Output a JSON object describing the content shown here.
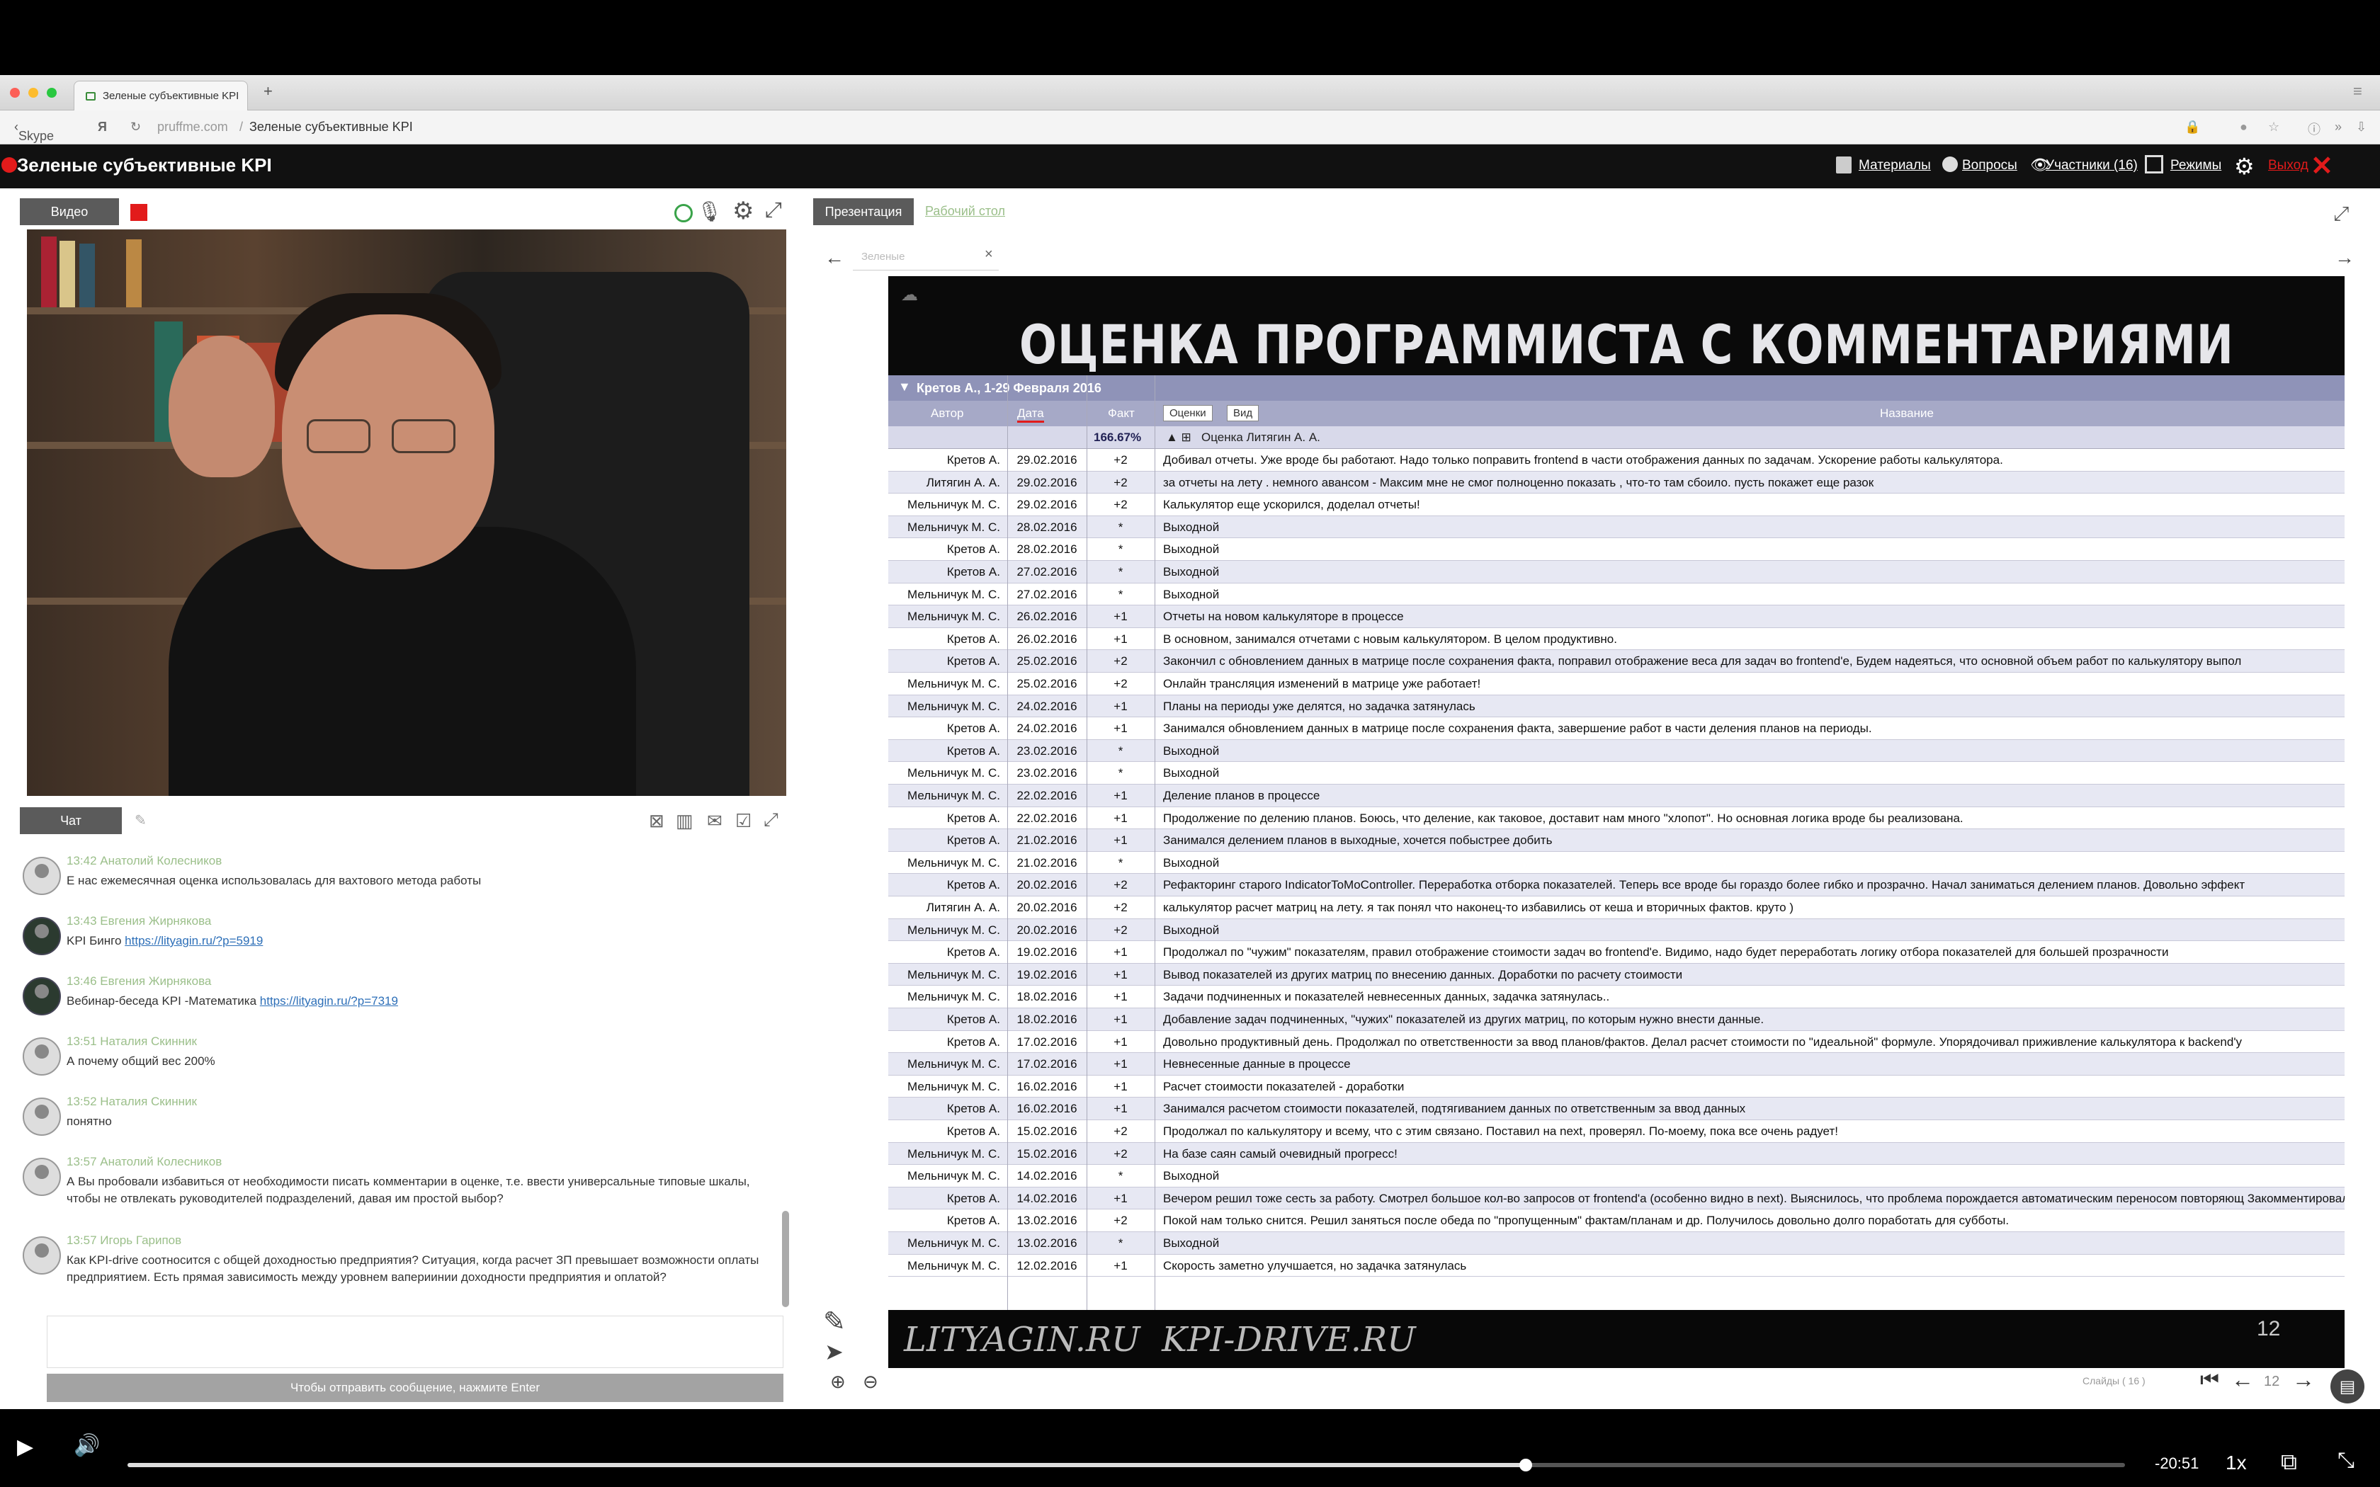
{
  "browser": {
    "tab_title": "Зеленые субъективные KPI",
    "new_tab": "+",
    "back_label": "Skype",
    "domain": "pruffme.com",
    "page_title": "Зеленые субъективные KPI"
  },
  "app": {
    "title": "Зеленые субъективные KPI",
    "nav": {
      "materials": "Материалы",
      "questions": "Вопросы",
      "participants": "Участники (16)",
      "modes": "Режимы",
      "exit": "Выход"
    }
  },
  "video_panel": {
    "tab": "Видео"
  },
  "chat": {
    "tab": "Чат",
    "messages": [
      {
        "time": "13:42",
        "author": "Анатолий Колесников",
        "text": "Е нас ежемесячная оценка использовалась для вахтового метода работы",
        "link": ""
      },
      {
        "time": "13:43",
        "author": "Евгения Жирнякова",
        "text": "KPI Бинго ",
        "link": "https://lityagin.ru/?p=5919"
      },
      {
        "time": "13:46",
        "author": "Евгения Жирнякова",
        "text": "Вебинар-беседа KPI -Математика ",
        "link": "https://lityagin.ru/?p=7319"
      },
      {
        "time": "13:51",
        "author": "Наталия Скинник",
        "text": "А почему общий вес 200%",
        "link": ""
      },
      {
        "time": "13:52",
        "author": "Наталия Скинник",
        "text": "понятно",
        "link": ""
      },
      {
        "time": "13:57",
        "author": "Анатолий Колесников",
        "text": "А Вы пробовали избавиться от необходимости писать комментарии в оценке, т.е. ввести универсальные типовые шкалы, чтобы не отвлекать руководителей подразделений, давая им простой выбор?",
        "link": ""
      },
      {
        "time": "13:57",
        "author": "Игорь Гарипов",
        "text": "Как KPI-drive соотносится с общей доходностью предприятия? Ситуация, когда расчет ЗП превышает возможности оплаты предприятием. Есть прямая зависимость между уровнем вапериинии доходности предприятия и оплатой?",
        "link": ""
      }
    ],
    "send_hint": "Чтобы отправить сообщение, нажмите Enter"
  },
  "presentation": {
    "tab": "Презентация",
    "tab2": "Рабочий стол",
    "file_field": "Зеленые",
    "slide_title": "ОЦЕНКА ПРОГРАММИСТА С КОММЕНТАРИЯМИ",
    "filter_bar": "Кретов А., 1-29 Февраля 2016",
    "headers": {
      "author": "Автор",
      "date": "Дата",
      "fact": "Факт",
      "chip1": "Оценки",
      "chip2": "Вид",
      "name": "Название"
    },
    "summary": {
      "fact": "166.67%",
      "title": "Оценка Литягин А. А."
    },
    "rows": [
      {
        "author": "Кретов А.",
        "date": "29.02.2016",
        "fact": "+2",
        "comment": "Добивал отчеты. Уже вроде бы работают. Надо только поправить frontend в части отображения данных по задачам. Ускорение работы калькулятора."
      },
      {
        "author": "Литягин А. А.",
        "date": "29.02.2016",
        "fact": "+2",
        "comment": "за отчеты на лету . немного авансом - Максим мне не смог полноценно показать , что-то там сбоило. пусть покажет еще разок"
      },
      {
        "author": "Мельничук М. С.",
        "date": "29.02.2016",
        "fact": "+2",
        "comment": "Калькулятор еще ускорился, доделал отчеты!"
      },
      {
        "author": "Мельничук М. С.",
        "date": "28.02.2016",
        "fact": "*",
        "comment": "Выходной"
      },
      {
        "author": "Кретов А.",
        "date": "28.02.2016",
        "fact": "*",
        "comment": "Выходной"
      },
      {
        "author": "Кретов А.",
        "date": "27.02.2016",
        "fact": "*",
        "comment": "Выходной"
      },
      {
        "author": "Мельничук М. С.",
        "date": "27.02.2016",
        "fact": "*",
        "comment": "Выходной"
      },
      {
        "author": "Мельничук М. С.",
        "date": "26.02.2016",
        "fact": "+1",
        "comment": "Отчеты на новом калькуляторе в процессе"
      },
      {
        "author": "Кретов А.",
        "date": "26.02.2016",
        "fact": "+1",
        "comment": "В основном, занимался отчетами с новым калькулятором. В целом продуктивно."
      },
      {
        "author": "Кретов А.",
        "date": "25.02.2016",
        "fact": "+2",
        "comment": "Закончил с обновлением данных в матрице после сохранения факта, поправил отображение веса для задач во frontend'е, Будем надеяться, что основной объем работ по калькулятору выпол"
      },
      {
        "author": "Мельничук М. С.",
        "date": "25.02.2016",
        "fact": "+2",
        "comment": "Онлайн трансляция изменений в матрице уже работает!"
      },
      {
        "author": "Мельничук М. С.",
        "date": "24.02.2016",
        "fact": "+1",
        "comment": "Планы на периоды уже делятся, но задачка затянулась"
      },
      {
        "author": "Кретов А.",
        "date": "24.02.2016",
        "fact": "+1",
        "comment": "Занимался обновлением данных в матрице после сохранения факта, завершение работ в части деления планов на периоды."
      },
      {
        "author": "Кретов А.",
        "date": "23.02.2016",
        "fact": "*",
        "comment": "Выходной"
      },
      {
        "author": "Мельничук М. С.",
        "date": "23.02.2016",
        "fact": "*",
        "comment": "Выходной"
      },
      {
        "author": "Мельничук М. С.",
        "date": "22.02.2016",
        "fact": "+1",
        "comment": "Деление планов в процессе"
      },
      {
        "author": "Кретов А.",
        "date": "22.02.2016",
        "fact": "+1",
        "comment": "Продолжение по делению планов. Боюсь, что деление, как таковое, доставит нам много \"хлопот\". Но основная логика вроде бы реализована."
      },
      {
        "author": "Кретов А.",
        "date": "21.02.2016",
        "fact": "+1",
        "comment": "Занимался делением планов в выходные, хочется побыстрее добить"
      },
      {
        "author": "Мельничук М. С.",
        "date": "21.02.2016",
        "fact": "*",
        "comment": "Выходной"
      },
      {
        "author": "Кретов А.",
        "date": "20.02.2016",
        "fact": "+2",
        "comment": "Рефакторинг старого IndicatorToMoController. Переработка отборка показателей. Теперь все вроде бы гораздо более гибко и прозрачно. Начал заниматься делением планов. Довольно эффект"
      },
      {
        "author": "Литягин А. А.",
        "date": "20.02.2016",
        "fact": "+2",
        "comment": "калькулятор расчет матриц на лету. я так понял что наконец-то избавились от кеша и вторичных фактов. круто )"
      },
      {
        "author": "Мельничук М. С.",
        "date": "20.02.2016",
        "fact": "+2",
        "comment": "Выходной"
      },
      {
        "author": "Кретов А.",
        "date": "19.02.2016",
        "fact": "+1",
        "comment": "Продолжал по \"чужим\" показателям, правил отображение стоимости задач во frontend'е. Видимо, надо будет переработать логику отбора показателей для большей прозрачности"
      },
      {
        "author": "Мельничук М. С.",
        "date": "19.02.2016",
        "fact": "+1",
        "comment": "Вывод показателей из других матриц по внесению данных. Доработки по расчету стоимости"
      },
      {
        "author": "Мельничук М. С.",
        "date": "18.02.2016",
        "fact": "+1",
        "comment": "Задачи подчиненных и показателей невнесенных данных, задачка затянулась.."
      },
      {
        "author": "Кретов А.",
        "date": "18.02.2016",
        "fact": "+1",
        "comment": "Добавление задач подчиненных, \"чужих\" показателей из других матриц, по которым нужно внести данные."
      },
      {
        "author": "Кретов А.",
        "date": "17.02.2016",
        "fact": "+1",
        "comment": "Довольно продуктивный день. Продолжал по ответственности за ввод планов/фактов. Делал расчет стоимости по \"идеальной\" формуле. Упорядочивал приживление калькулятора к backend'у"
      },
      {
        "author": "Мельничук М. С.",
        "date": "17.02.2016",
        "fact": "+1",
        "comment": "Невнесенные данные в процессе"
      },
      {
        "author": "Мельничук М. С.",
        "date": "16.02.2016",
        "fact": "+1",
        "comment": "Расчет стоимости показателей - доработки"
      },
      {
        "author": "Кретов А.",
        "date": "16.02.2016",
        "fact": "+1",
        "comment": "Занимался расчетом стоимости показателей, подтягиванием данных по ответственным за ввод данных"
      },
      {
        "author": "Кретов А.",
        "date": "15.02.2016",
        "fact": "+2",
        "comment": "Продолжал по калькулятору и всему, что с этим связано. Поставил на next, проверял. По-моему, пока все очень радует!"
      },
      {
        "author": "Мельничук М. С.",
        "date": "15.02.2016",
        "fact": "+2",
        "comment": "На базе саян самый очевидный прогресс!"
      },
      {
        "author": "Мельничук М. С.",
        "date": "14.02.2016",
        "fact": "*",
        "comment": "Выходной"
      },
      {
        "author": "Кретов А.",
        "date": "14.02.2016",
        "fact": "+1",
        "comment": "Вечером решил тоже сесть за работу. Смотрел большое кол-во запросов от frontend'а (особенно видно в next). Выяснилось, что проблема порождается автоматическим переносом повторяющ Закомментировал в php. Надо это реализовывать в backend'е."
      },
      {
        "author": "Кретов А.",
        "date": "13.02.2016",
        "fact": "+2",
        "comment": "Покой нам только снится. Решил заняться после обеда по \"пропущенным\" фактам/планам и др. Получилось довольно долго поработать для субботы."
      },
      {
        "author": "Мельничук М. С.",
        "date": "13.02.2016",
        "fact": "*",
        "comment": "Выходной"
      },
      {
        "author": "Мельничук М. С.",
        "date": "12.02.2016",
        "fact": "+1",
        "comment": "Скорость заметно улучшается, но задачка затянулась"
      }
    ],
    "footer_text": "LITYAGIN.RU  KPI-DRIVE.RU",
    "slide_number": "12",
    "slides_label": "Слайды ( 16 )",
    "page_value": "12"
  },
  "player": {
    "time_remaining": "-20:51",
    "speed": "1x",
    "progress": 0.7
  },
  "colors": {
    "accent_red": "#e21b1b",
    "header_bg": "#111111",
    "grid_header": "#a6a9c7",
    "link": "#2d6fb8",
    "author_green": "#9bbf8a"
  }
}
